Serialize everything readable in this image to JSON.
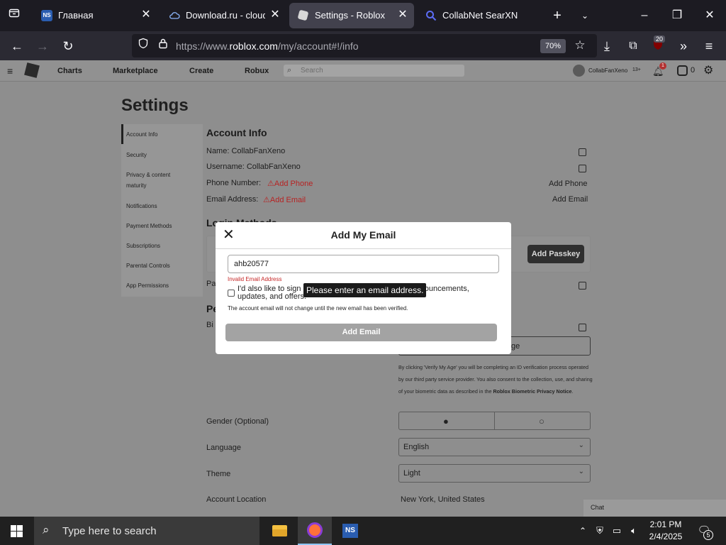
{
  "browser": {
    "tabs": [
      {
        "title": "Главная",
        "favicon": "NS"
      },
      {
        "title": "Download.ru - cloud st",
        "favicon": "cloud-icon"
      },
      {
        "title": "Settings - Roblox",
        "favicon": "roblox-icon"
      },
      {
        "title": "CollabNet SearXNG",
        "favicon": "search-icon"
      }
    ],
    "url": "https://www.roblox.com/my/account#!/info",
    "url_domain": "roblox.com",
    "zoom": "70%",
    "extension_badge": "20"
  },
  "roblox": {
    "nav": [
      "Charts",
      "Marketplace",
      "Create",
      "Robux"
    ],
    "search_placeholder": "Search",
    "username": "CollabFanXeno",
    "age_badge": "13+",
    "notification_count": "1",
    "robux_balance": "0"
  },
  "settings": {
    "title": "Settings",
    "sidebar": [
      "Account Info",
      "Security",
      "Privacy & content maturity",
      "Notifications",
      "Payment Methods",
      "Subscriptions",
      "Parental Controls",
      "App Permissions"
    ],
    "account_info_heading": "Account Info",
    "name_label": "Name: CollabFanXeno",
    "username_label": "Username: CollabFanXeno",
    "phone_label": "Phone Number:",
    "phone_warning": "Add Phone",
    "phone_action": "Add Phone",
    "email_label": "Email Address:",
    "email_warning": "Add Email",
    "email_action": "Add Email",
    "login_methods_heading": "Login Methods",
    "add_passkey": "Add Passkey",
    "password_partial": "Pa",
    "personal_heading_partial": "Pe",
    "birthday_partial": "Bi",
    "verify_button_partial": "ge",
    "verify_notice": "By clicking 'Verify My Age' you will be completing an ID verification process operated by our third party service provider. You also consent to the collection, use, and sharing of your biometric data as described in the",
    "verify_notice_link": "Roblox Biometric Privacy Notice",
    "gender_label": "Gender (Optional)",
    "language_label": "Language",
    "language_value": "English",
    "theme_label": "Theme",
    "theme_value": "Light",
    "location_label": "Account Location",
    "location_value": "New York, United States",
    "chat": "Chat"
  },
  "modal": {
    "title": "Add My Email",
    "email_value": "ahb20577",
    "error": "Invalid Email Address",
    "tooltip": "Please enter an email address.",
    "checkbox_text": "I'd also like to sign up for news from Roblox about announcements, updates, and offers.",
    "note": "The account email will not change until the new email has been verified.",
    "submit": "Add Email"
  },
  "taskbar": {
    "search_placeholder": "Type here to search",
    "time": "2:01 PM",
    "date": "2/4/2025",
    "notifications": "5"
  },
  "colors": {
    "browser_bg": "#1c1b22",
    "toolbar": "#2b2a33",
    "overlay": "#8e8e8e",
    "error": "#c62828",
    "taskbar": "#202020"
  }
}
